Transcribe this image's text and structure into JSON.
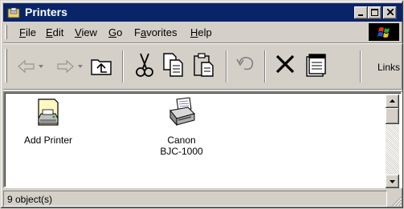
{
  "window": {
    "title": "Printers"
  },
  "title_buttons": {
    "minimize": "_",
    "maximize": "□",
    "close": "×"
  },
  "menu": {
    "items": [
      {
        "label": "File",
        "accel": "F",
        "rest": "ile"
      },
      {
        "label": "Edit",
        "accel": "E",
        "rest": "dit"
      },
      {
        "label": "View",
        "accel": "V",
        "rest": "iew"
      },
      {
        "label": "Go",
        "accel": "G",
        "rest": "o"
      },
      {
        "label": "Favorites",
        "accel_pre": "F",
        "accel": "a",
        "rest": "vorites"
      },
      {
        "label": "Help",
        "accel": "H",
        "rest": "elp"
      }
    ]
  },
  "toolbar": {
    "buttons": [
      "back-icon",
      "forward-icon",
      "up-folder-icon",
      "cut-icon",
      "copy-icon",
      "paste-icon",
      "undo-icon",
      "delete-icon",
      "properties-icon"
    ],
    "links_label": "Links"
  },
  "items": [
    {
      "label_line1": "Add Printer",
      "label_line2": "",
      "icon": "add-printer-icon"
    },
    {
      "label_line1": "Canon",
      "label_line2": "BJC-1000",
      "icon": "printer-icon"
    }
  ],
  "status": {
    "text": "9 object(s)"
  },
  "colors": {
    "titlebar": "#0a246a",
    "face": "#d4d0c8",
    "content_bg": "#ffffff"
  }
}
